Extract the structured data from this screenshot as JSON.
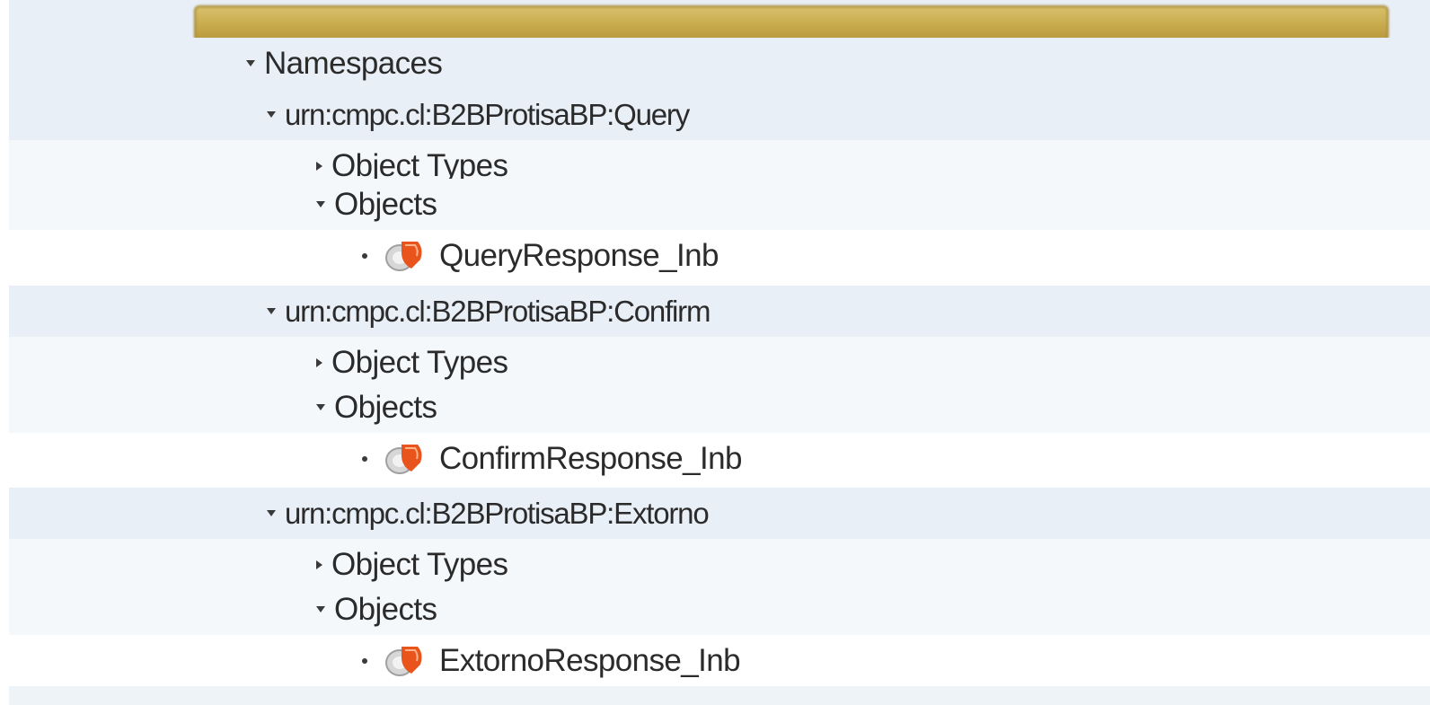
{
  "tree": {
    "namespaces_label": "Namespaces",
    "namespaces": [
      {
        "name": "urn:cmpc.cl:B2BProtisaBP:Query",
        "object_types_label": "Object Types",
        "objects_label": "Objects",
        "objects": [
          "QueryResponse_Inb"
        ]
      },
      {
        "name": "urn:cmpc.cl:B2BProtisaBP:Confirm",
        "object_types_label": "Object Types",
        "objects_label": "Objects",
        "objects": [
          "ConfirmResponse_Inb"
        ]
      },
      {
        "name": "urn:cmpc.cl:B2BProtisaBP:Extorno",
        "object_types_label": "Object Types",
        "objects_label": "Objects",
        "objects": [
          "ExtornoResponse_Inb"
        ]
      }
    ]
  },
  "colors": {
    "row_alt": "#e9eff6",
    "selected_node": "#c8ab4e",
    "object_icon": "#e8541b"
  },
  "icons": {
    "expanded": "expand-arrow-down-icon",
    "collapsed": "expand-arrow-right-icon",
    "leaf": "bullet-icon",
    "object": "interface-object-icon"
  }
}
